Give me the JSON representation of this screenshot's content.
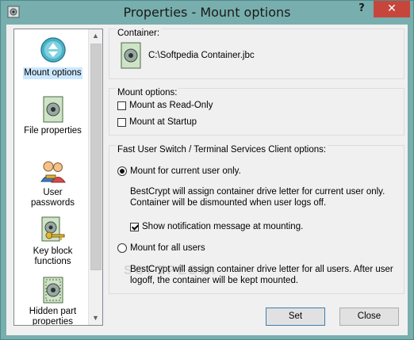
{
  "window": {
    "title": "Properties - Mount options",
    "help_label": "?",
    "close_label": "✕"
  },
  "sidebar": {
    "items": [
      {
        "label": "Mount options",
        "icon": "mount-options-icon",
        "selected": true
      },
      {
        "label": "File properties",
        "icon": "file-properties-icon",
        "selected": false
      },
      {
        "label": "User passwords",
        "icon": "user-passwords-icon",
        "selected": false
      },
      {
        "label": "Key block functions",
        "icon": "key-block-icon",
        "selected": false
      },
      {
        "label": "Hidden part properties",
        "icon": "hidden-part-icon",
        "selected": false
      }
    ]
  },
  "container": {
    "heading": "Container:",
    "path": "C:\\Softpedia Container.jbc"
  },
  "mount_options": {
    "heading": "Mount options:",
    "read_only": {
      "label": "Mount as Read-Only",
      "checked": false
    },
    "at_startup": {
      "label": "Mount at Startup",
      "checked": false
    }
  },
  "fast_user": {
    "heading": "Fast User Switch / Terminal Services Client options:",
    "current_user": {
      "label": "Mount for current user only.",
      "selected": true,
      "desc_line1": "BestCrypt will assign container drive letter for current user only.",
      "desc_line2": "Container will be dismounted when user logs off."
    },
    "notify": {
      "label": "Show notification message at mounting.",
      "checked": true
    },
    "all_users": {
      "label": "Mount for all users",
      "selected": false,
      "desc_line1": "BestCrypt will assign container drive letter for all users. After user",
      "desc_line2": "logoff, the container will be kept mounted."
    }
  },
  "buttons": {
    "set": "Set",
    "close": "Close"
  },
  "watermark": "SOFTPEDIA",
  "colors": {
    "title_bar": "#78aeae",
    "close_button": "#c7463c",
    "selection": "#cce8ff"
  }
}
